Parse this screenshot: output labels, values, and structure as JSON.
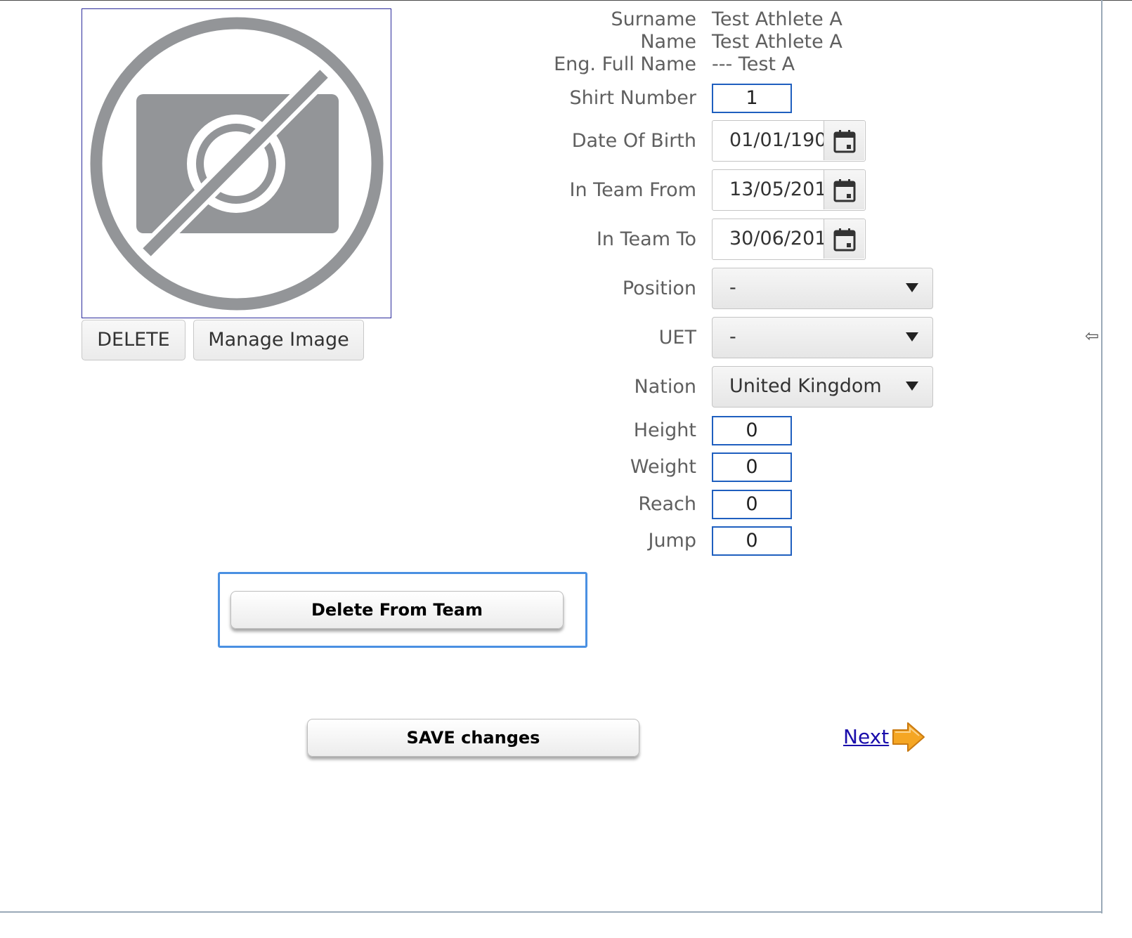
{
  "image_panel": {
    "placeholder_icon": "no-photo-icon",
    "delete_label": "DELETE",
    "manage_label": "Manage Image"
  },
  "athlete": {
    "surname_label": "Surname",
    "surname_value": "Test Athlete A",
    "name_label": "Name",
    "name_value": "Test Athlete A",
    "eng_full_name_label": "Eng. Full Name",
    "eng_full_name_value": "--- Test A"
  },
  "form": {
    "shirt_number": {
      "label": "Shirt Number",
      "value": "1"
    },
    "date_of_birth": {
      "label": "Date Of Birth",
      "value": "01/01/190",
      "icon": "calendar-icon"
    },
    "in_team_from": {
      "label": "In Team From",
      "value": "13/05/201",
      "icon": "calendar-icon"
    },
    "in_team_to": {
      "label": "In Team To",
      "value": "30/06/201",
      "icon": "calendar-icon"
    },
    "position": {
      "label": "Position",
      "value": "-"
    },
    "uet": {
      "label": "UET",
      "value": "-"
    },
    "nation": {
      "label": "Nation",
      "value": "United Kingdom"
    },
    "height": {
      "label": "Height",
      "value": "0"
    },
    "weight": {
      "label": "Weight",
      "value": "0"
    },
    "reach": {
      "label": "Reach",
      "value": "0"
    },
    "jump": {
      "label": "Jump",
      "value": "0"
    }
  },
  "actions": {
    "delete_from_team_label": "Delete From Team",
    "save_label": "SAVE changes",
    "next_label": "Next",
    "next_icon": "arrow-right-icon"
  },
  "colors": {
    "input_border": "#1f5fbf",
    "focus_ring": "#4a90e2",
    "link": "#1a0dab",
    "arrow_fill": "#f5a623"
  }
}
